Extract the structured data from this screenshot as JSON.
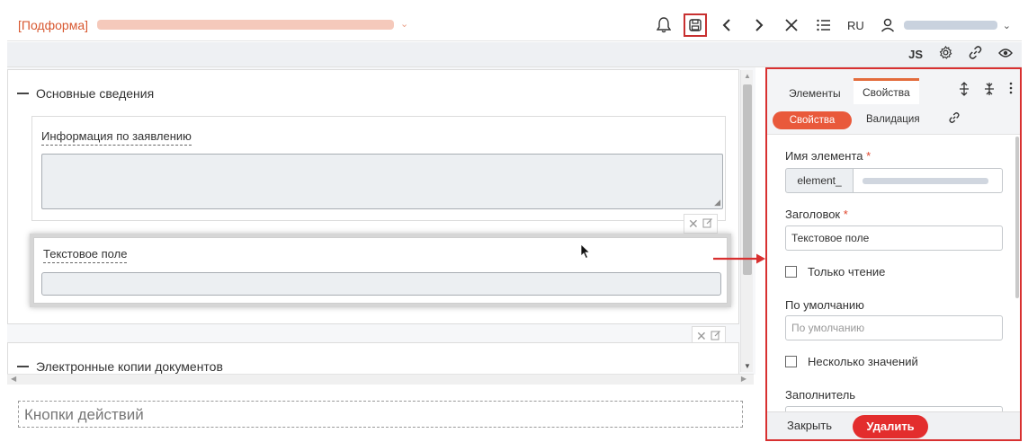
{
  "header": {
    "title": "[Подформа]",
    "language": "RU"
  },
  "subtoolbar": {
    "js_label": "JS"
  },
  "form": {
    "section1": {
      "title": "Основные сведения",
      "field1_label": "Информация по заявлению",
      "field2_label": "Текстовое поле"
    },
    "section2": {
      "title": "Электронные копии документов"
    },
    "actions_placeholder": "Кнопки действий"
  },
  "panel": {
    "tabs": [
      "Элементы",
      "Свойства"
    ],
    "subtabs": [
      "Свойства",
      "Валидация"
    ],
    "name_label": "Имя элемента",
    "name_prefix": "element_",
    "title_label": "Заголовок",
    "title_value": "Текстовое поле",
    "readonly_label": "Только чтение",
    "default_label": "По умолчанию",
    "default_placeholder": "По умолчанию",
    "multiple_label": "Несколько значений",
    "filler_label": "Заполнитель",
    "required_mark": "*",
    "close_button": "Закрыть",
    "delete_button": "Удалить"
  },
  "colors": {
    "accent": "#e9593b",
    "delete": "#e32d2d",
    "highlight_border": "#d83030",
    "title": "#d85830"
  }
}
